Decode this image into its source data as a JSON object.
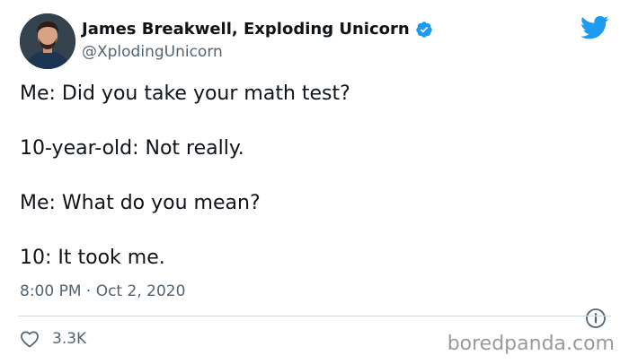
{
  "author": {
    "display_name": "James Breakwell, Exploding Unicorn",
    "handle": "@XplodingUnicorn",
    "verified": true
  },
  "tweet": {
    "lines": [
      "Me: Did you take your math test?",
      "10-year-old: Not really.",
      "Me: What do you mean?",
      "10: It took me."
    ],
    "timestamp": "8:00 PM · Oct 2, 2020"
  },
  "actions": {
    "like_count": "3.3K"
  },
  "watermark": "boredpanda.com",
  "icons": {
    "brand": "twitter-bird-icon",
    "verified": "verified-badge-icon",
    "info": "info-icon",
    "like": "heart-icon"
  },
  "colors": {
    "twitter_blue": "#1d9bf0",
    "text_primary": "#0f1419",
    "text_secondary": "#536471",
    "divider": "#cfd9de",
    "watermark": "#9a9a9a"
  }
}
